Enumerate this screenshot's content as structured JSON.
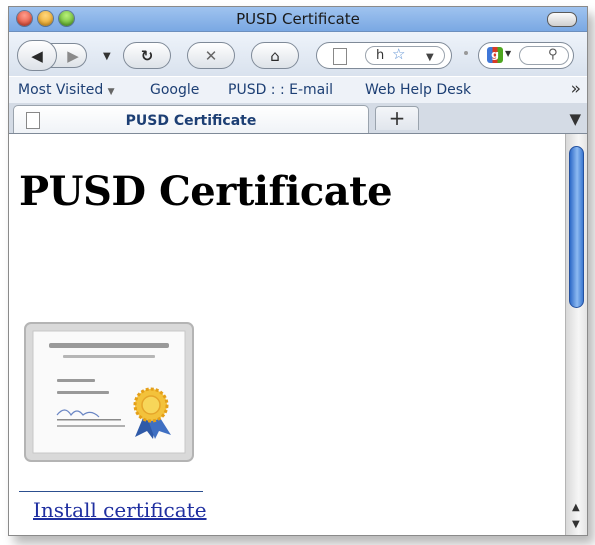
{
  "window": {
    "title": "PUSD Certificate"
  },
  "navbar": {
    "back_icon": "back-arrow-icon",
    "forward_icon": "forward-arrow-icon",
    "reload_icon": "reload-icon",
    "stop_icon": "stop-icon",
    "home_icon": "home-icon",
    "url_text": "h",
    "search_engine_icon": "google-icon",
    "search_icon": "magnifier-icon"
  },
  "bookmarks": {
    "items": [
      {
        "label": "Most Visited"
      },
      {
        "label": "Google"
      },
      {
        "label": "PUSD : : E-mail"
      },
      {
        "label": "Web Help Desk"
      }
    ],
    "overflow": "»"
  },
  "tabs": {
    "active": "PUSD Certificate",
    "new_tab": "+"
  },
  "page": {
    "heading": "PUSD Certificate",
    "link_text": "Install certificate",
    "colors": {
      "link": "#1f2fa0",
      "accent": "#3b78d1"
    }
  }
}
